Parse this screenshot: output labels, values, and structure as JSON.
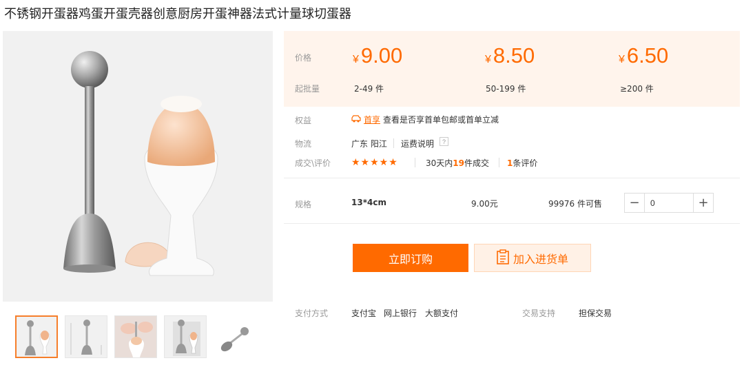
{
  "title": "不锈钢开蛋器鸡蛋开蛋壳器创意厨房开蛋神器法式计量球切蛋器",
  "colors": {
    "accent": "#ff6a00",
    "price_bg": "#fff4ec"
  },
  "price_block": {
    "price_label": "价格",
    "qty_label": "起批量",
    "currency": "¥",
    "tiers": [
      {
        "price": "9.00",
        "range": "2-49 件"
      },
      {
        "price": "8.50",
        "range": "50-199 件"
      },
      {
        "price": "6.50",
        "range": "≥200 件"
      }
    ]
  },
  "rights": {
    "label": "权益",
    "badge_icon": "car-icon",
    "badge": "首享",
    "text": "查看是否享首单包邮或首单立减"
  },
  "logistics": {
    "label": "物流",
    "location": "广东 阳江",
    "freight": "运费说明",
    "help_icon": "question-icon"
  },
  "reviews": {
    "label": "成交\\评价",
    "stars": "★★★★★",
    "rating": 5,
    "deals_prefix": "30天内",
    "deals_count": "19",
    "deals_suffix": "件成交",
    "review_count": "1",
    "review_suffix": "条评价"
  },
  "spec": {
    "label": "规格",
    "size": "13*4cm",
    "price": "9.00元",
    "stock": "99976 件可售",
    "quantity": "0",
    "minus": "−",
    "plus": "+"
  },
  "actions": {
    "order": "立即订购",
    "cart": "加入进货单",
    "cart_icon": "clipboard-icon"
  },
  "payment": {
    "label": "支付方式",
    "methods": [
      "支付宝",
      "网上银行",
      "大额支付"
    ],
    "support_label": "交易支持",
    "support": "担保交易"
  }
}
